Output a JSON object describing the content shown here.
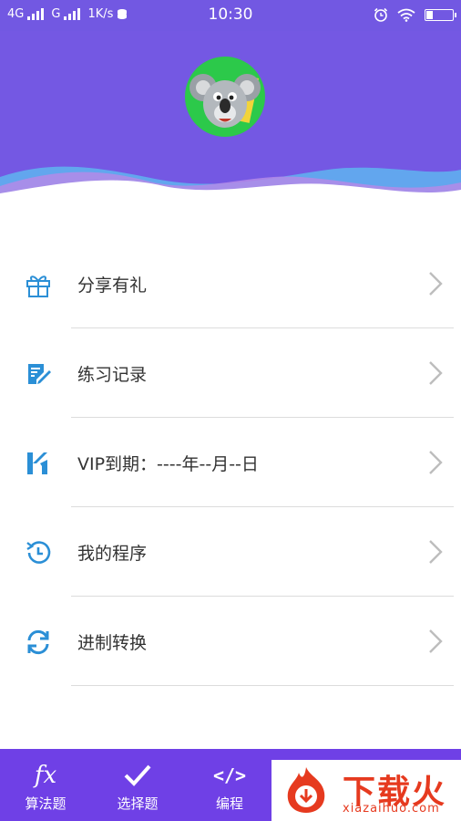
{
  "status_bar": {
    "network1": "4G",
    "network2": "G",
    "speed": "1K/s",
    "time": "10:30"
  },
  "profile": {
    "avatar": "koala-avatar"
  },
  "menu": {
    "items": [
      {
        "label": "分享有礼",
        "icon": "gift-icon"
      },
      {
        "label": "练习记录",
        "icon": "edit-note-icon"
      },
      {
        "label": "VIP到期：----年--月--日",
        "icon": "vip-icon"
      },
      {
        "label": "我的程序",
        "icon": "history-clock-icon"
      },
      {
        "label": "进制转换",
        "icon": "refresh-icon"
      }
    ]
  },
  "tabbar": {
    "tabs": [
      {
        "icon_text": "fx",
        "label": "算法题"
      },
      {
        "icon_text": "✔",
        "label": "选择题"
      },
      {
        "icon_text": "</>",
        "label": "编程"
      }
    ]
  },
  "watermark": {
    "title": "下载火",
    "url": "xiazaihuo.com"
  },
  "colors": {
    "accent": "#7458e3",
    "tabbar": "#6f40e6",
    "icon_blue": "#2b8fd6",
    "watermark_red": "#e63a1f"
  }
}
